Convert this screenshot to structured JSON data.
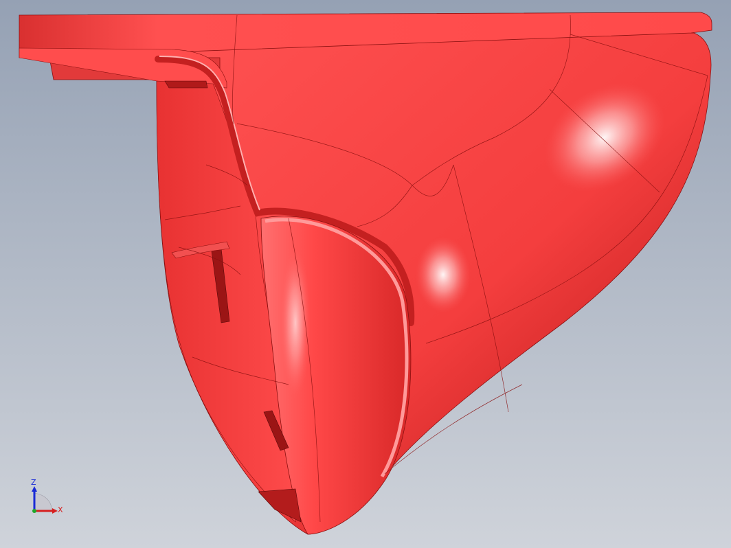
{
  "viewport": {
    "background_top": "#95a1b4",
    "background_bottom": "#cfd3da"
  },
  "model": {
    "part_color": "#ff4444",
    "edge_color": "#8a1010",
    "highlight_color": "#ffffff",
    "shading": "shaded-with-edges"
  },
  "triad": {
    "z_label": "Z",
    "x_label": "X",
    "z_color": "#1a2bd6",
    "x_color": "#d62020",
    "y_color": "#1fa82a"
  }
}
